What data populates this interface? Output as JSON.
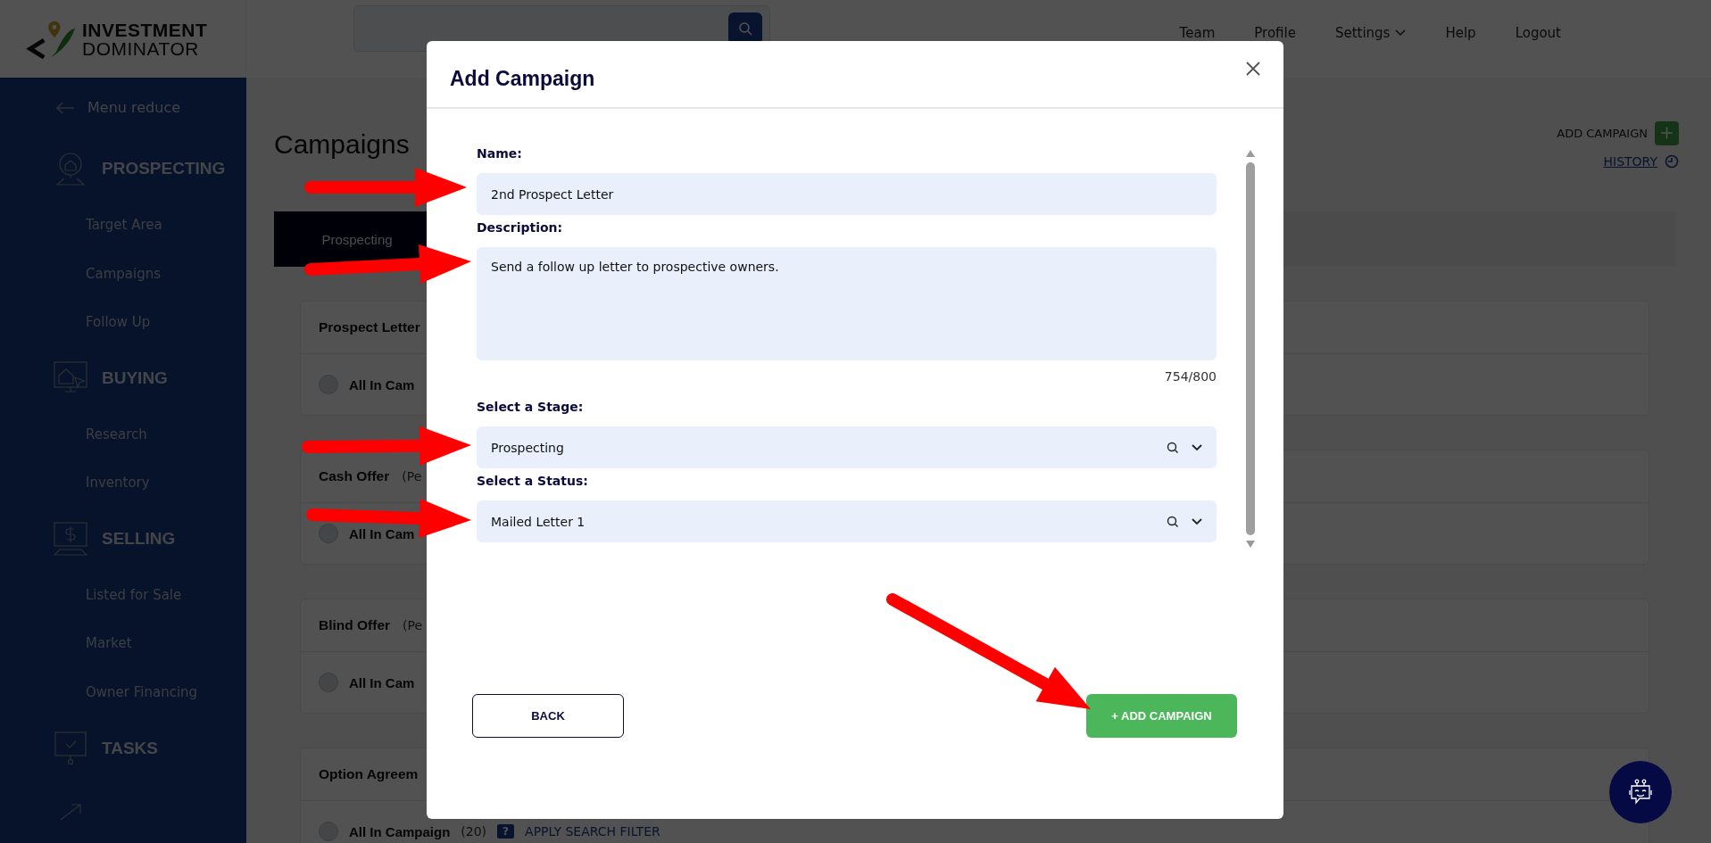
{
  "logo": {
    "line1": "INVESTMENT",
    "line2": "DOMINATOR"
  },
  "header": {
    "nav": [
      {
        "label": "Team",
        "kind": "link"
      },
      {
        "label": "Profile",
        "kind": "link"
      },
      {
        "label": "Settings",
        "kind": "dropdown"
      },
      {
        "label": "Help",
        "kind": "link"
      },
      {
        "label": "Logout",
        "kind": "link"
      }
    ]
  },
  "sidebar": {
    "collapse": "Menu reduce",
    "sections": [
      {
        "title": "PROSPECTING",
        "items": [
          "Target Area",
          "Campaigns",
          "Follow Up"
        ]
      },
      {
        "title": "BUYING",
        "items": [
          "Research",
          "Inventory"
        ]
      },
      {
        "title": "SELLING",
        "items": [
          "Listed for Sale",
          "Market",
          "Owner Financing"
        ]
      },
      {
        "title": "TASKS"
      }
    ]
  },
  "page": {
    "title": "Campaigns",
    "add_campaign": "ADD CAMPAIGN",
    "history": "HISTORY",
    "tabs": [
      {
        "label": "Prospecting",
        "selected": true
      }
    ],
    "cards": [
      {
        "title": "Prospect Letter",
        "row": {
          "label": "All In Cam",
          "checked": false
        }
      },
      {
        "title": "Cash Offer",
        "subtitle": "(Pe",
        "row": {
          "label": "All In Cam",
          "checked": false
        }
      },
      {
        "title": "Blind Offer",
        "subtitle": "(Pe",
        "row": {
          "label": "All In Cam",
          "checked": false
        }
      },
      {
        "title": "Option Agreem",
        "row": {
          "label": "All In Campaign",
          "count": "(20)",
          "help": "?",
          "filter": "APPLY SEARCH FILTER",
          "checked": false
        }
      }
    ]
  },
  "modal": {
    "title": "Add Campaign",
    "fields": [
      {
        "kind": "input",
        "label": "Name:",
        "value": "2nd Prospect Letter"
      },
      {
        "kind": "textarea",
        "label": "Description:",
        "value": "Send a follow up letter to prospective owners.",
        "counter": "754/800"
      },
      {
        "kind": "select",
        "label": "Select a Stage:",
        "value": "Prospecting"
      },
      {
        "kind": "select",
        "label": "Select a Status:",
        "value": "Mailed Letter 1"
      }
    ],
    "back": "BACK",
    "submit": "+ ADD CAMPAIGN"
  }
}
